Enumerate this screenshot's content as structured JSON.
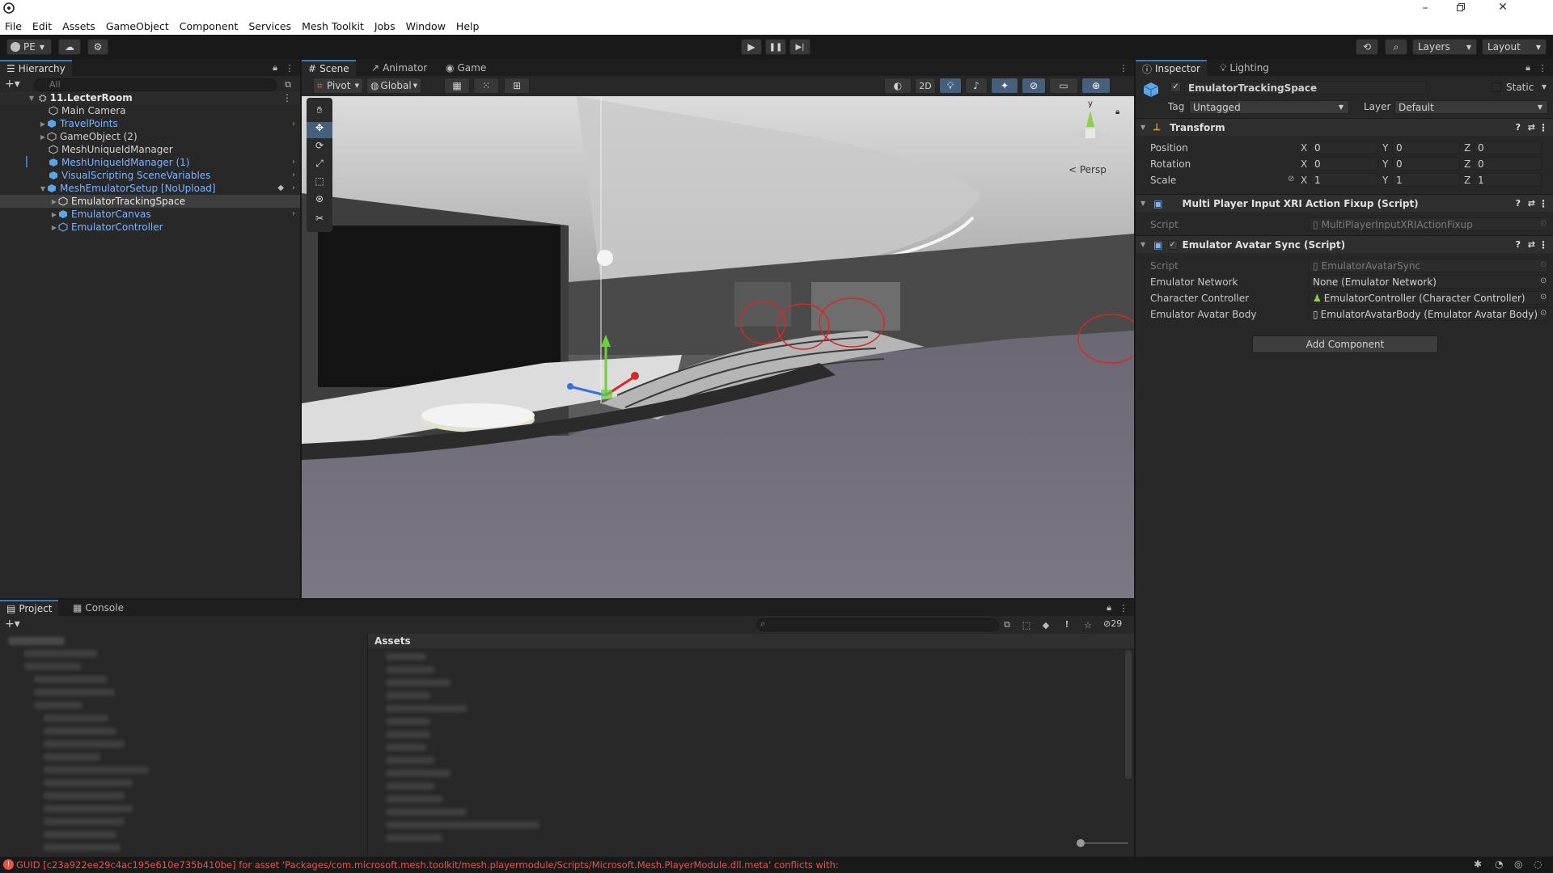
{
  "window": {
    "title": ""
  },
  "menu": [
    "File",
    "Edit",
    "Assets",
    "GameObject",
    "Component",
    "Services",
    "Mesh Toolkit",
    "Jobs",
    "Window",
    "Help"
  ],
  "toolbar": {
    "account": "PE",
    "layers": "Layers",
    "layout": "Layout"
  },
  "hierarchy": {
    "tab": "Hierarchy",
    "search_placeholder": "All",
    "scene": "11.LecterRoom",
    "items": [
      {
        "label": "Main Camera",
        "prefab": false
      },
      {
        "label": "TravelPoints",
        "prefab": true
      },
      {
        "label": "GameObject (2)",
        "prefab": false
      },
      {
        "label": "MeshUniqueIdManager",
        "prefab": false
      },
      {
        "label": "MeshUniqueIdManager (1)",
        "prefab": true
      },
      {
        "label": "VisualScripting SceneVariables",
        "prefab": true
      },
      {
        "label": "MeshEmulatorSetup [NoUpload]",
        "prefab": true
      },
      {
        "label": "EmulatorTrackingSpace",
        "prefab": false
      },
      {
        "label": "EmulatorCanvas",
        "prefab": true
      },
      {
        "label": "EmulatorController",
        "prefab": true
      }
    ]
  },
  "scene_view": {
    "tabs": [
      "Scene",
      "Animator",
      "Game"
    ],
    "pivot": "Pivot",
    "global": "Global",
    "mode_2d": "2D",
    "persp": "< Persp",
    "gizmo_y": "y"
  },
  "inspector": {
    "tabs": [
      "Inspector",
      "Lighting"
    ],
    "object_name": "EmulatorTrackingSpace",
    "static_label": "Static",
    "tag_label": "Tag",
    "tag_value": "Untagged",
    "layer_label": "Layer",
    "layer_value": "Default",
    "transform": {
      "title": "Transform",
      "rows": [
        {
          "label": "Position",
          "x": "0",
          "y": "0",
          "z": "0"
        },
        {
          "label": "Rotation",
          "x": "0",
          "y": "0",
          "z": "0"
        },
        {
          "label": "Scale",
          "x": "1",
          "y": "1",
          "z": "1"
        }
      ],
      "axis_x": "X",
      "axis_y": "Y",
      "axis_z": "Z"
    },
    "multiplayer": {
      "title": "Multi Player Input XRI Action Fixup (Script)",
      "script_label": "Script",
      "script_value": "MultiPlayerInputXRIActionFixup"
    },
    "avatar_sync": {
      "title": "Emulator Avatar Sync (Script)",
      "script_label": "Script",
      "script_value": "EmulatorAvatarSync",
      "fields": [
        {
          "label": "Emulator Network",
          "value": "None (Emulator Network)"
        },
        {
          "label": "Character Controller",
          "value": "EmulatorController (Character Controller)"
        },
        {
          "label": "Emulator Avatar Body",
          "value": "EmulatorAvatarBody (Emulator Avatar Body)"
        }
      ]
    },
    "add_component": "Add Component"
  },
  "project": {
    "tabs": [
      "Project",
      "Console"
    ],
    "assets_header": "Assets",
    "hidden_count": "29"
  },
  "status": {
    "message": "GUID [c23a922ee29c4ac195e610e735b410be] for asset 'Packages/com.microsoft.mesh.toolkit/mesh.playermodule/Scripts/Microsoft.Mesh.PlayerModule.dll.meta' conflicts with:"
  },
  "colors": {
    "accent": "#3a79bb",
    "prefab_blue": "#7cb3ff",
    "error_red": "#e8534a",
    "scene_sky": "#8a8a8a"
  }
}
